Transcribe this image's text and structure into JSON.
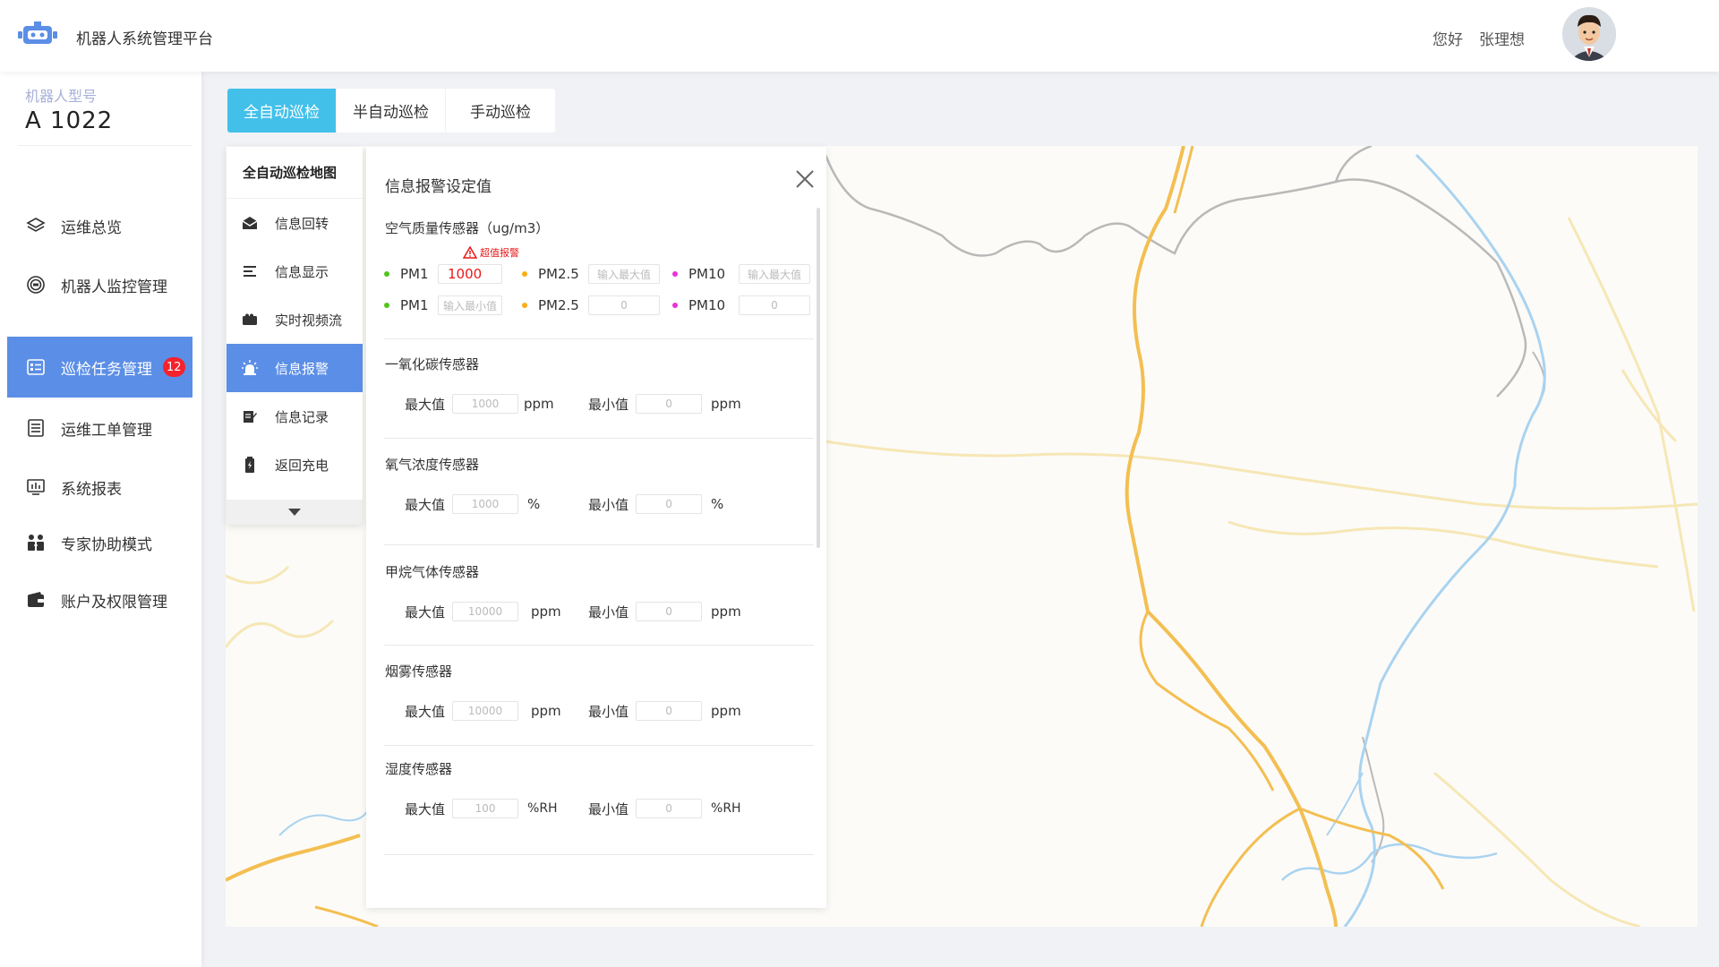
{
  "header": {
    "app_title": "机器人系统管理平台",
    "greeting": "您好",
    "username": "张理想"
  },
  "sidebar": {
    "model_label": "机器人型号",
    "model_value": "A 1022",
    "items": [
      {
        "label": "运维总览",
        "icon": "layers-icon"
      },
      {
        "label": "机器人监控管理",
        "icon": "robot-monitor-icon"
      },
      {
        "label": "巡检任务管理",
        "icon": "task-list-icon",
        "badge": "12",
        "active": true
      },
      {
        "label": "运维工单管理",
        "icon": "work-order-icon"
      },
      {
        "label": "系统报表",
        "icon": "report-icon"
      },
      {
        "label": "专家协助模式",
        "icon": "expert-icon"
      },
      {
        "label": "账户及权限管理",
        "icon": "wallet-icon"
      }
    ]
  },
  "tabs": [
    {
      "label": "全自动巡检",
      "active": true
    },
    {
      "label": "半自动巡检"
    },
    {
      "label": "手动巡检"
    }
  ],
  "submenu": {
    "title": "全自动巡检地图",
    "items": [
      {
        "label": "信息回转",
        "icon": "mail-open-icon"
      },
      {
        "label": "信息显示",
        "icon": "list-lines-icon"
      },
      {
        "label": "实时视频流",
        "icon": "video-camera-icon"
      },
      {
        "label": "信息报警",
        "icon": "alarm-light-icon",
        "active": true
      },
      {
        "label": "信息记录",
        "icon": "edit-record-icon"
      },
      {
        "label": "返回充电",
        "icon": "battery-charge-icon"
      }
    ]
  },
  "panel": {
    "title": "信息报警设定值",
    "air": {
      "title": "空气质量传感器（ug/m3）",
      "warning": "超值报警",
      "pm1": "PM1",
      "pm25": "PM2.5",
      "pm10": "PM10",
      "max_pm1_value": "1000",
      "max_placeholder": "输入最大值",
      "min_placeholder": "输入最小值",
      "min_pm25_value": "0",
      "min_pm10_value": "0"
    },
    "max_label": "最大值",
    "min_label": "最小值",
    "co": {
      "title": "一氧化碳传感器",
      "max": "1000",
      "min": "0",
      "unit": "ppm"
    },
    "o2": {
      "title": "氧气浓度传感器",
      "max": "1000",
      "min": "0",
      "unit": "%"
    },
    "ch4": {
      "title": "甲烷气体传感器",
      "max": "10000",
      "min": "0",
      "unit": "ppm"
    },
    "smoke": {
      "title": "烟雾传感器",
      "max": "10000",
      "min": "0",
      "unit": "ppm"
    },
    "humidity": {
      "title": "湿度传感器",
      "max": "100",
      "min": "0",
      "unit": "%RH"
    }
  },
  "colors": {
    "accent_blue": "#5b8ee6",
    "tab_active": "#42c0ea",
    "badge_red": "#f5222d",
    "pm1_dot": "#52c41a",
    "pm25_dot": "#faad14",
    "pm10_dot": "#eb2fd6"
  }
}
